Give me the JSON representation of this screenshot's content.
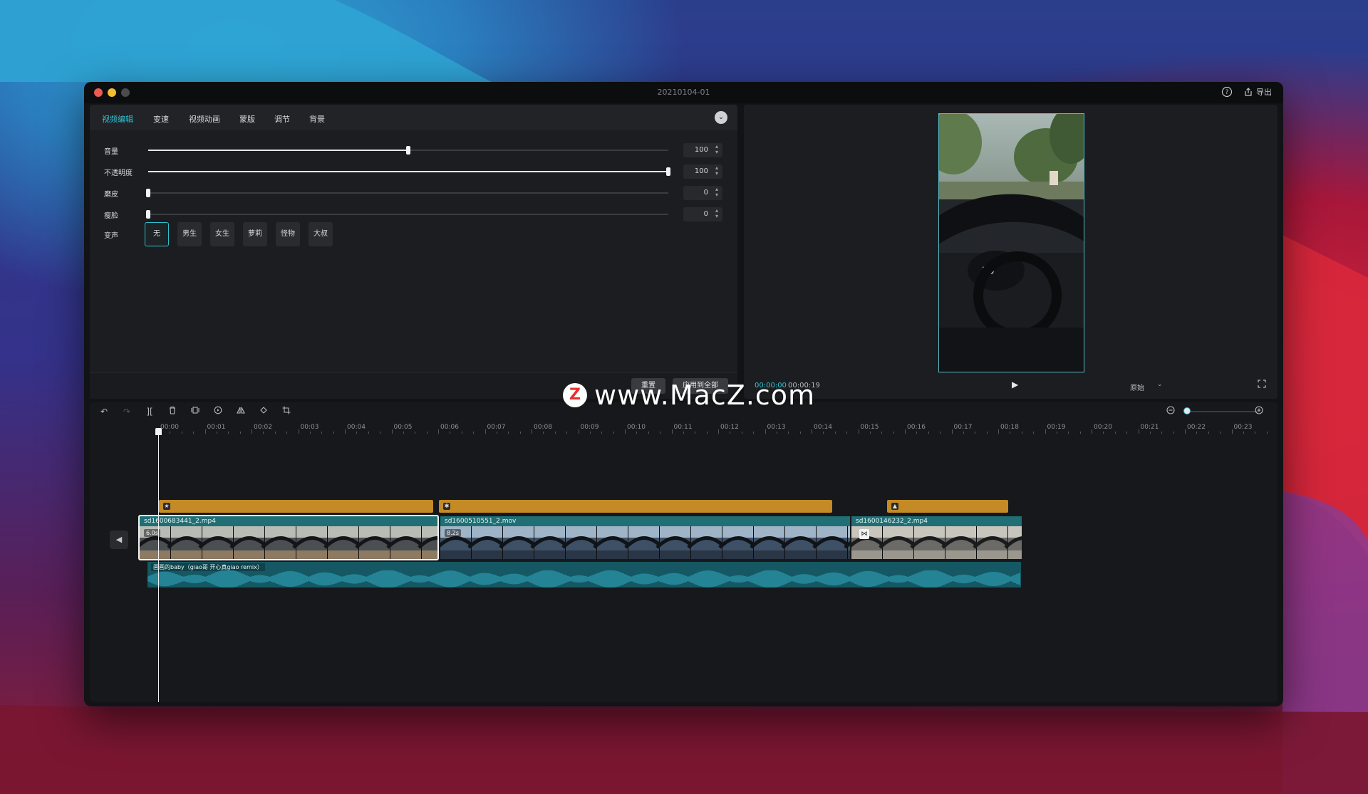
{
  "window": {
    "title": "20210104-01",
    "export_label": "导出"
  },
  "colors": {
    "accent": "#2fc0d0",
    "fx_bar": "#c48a25",
    "clip": "#1f6f74",
    "audio": "#155863"
  },
  "tabs": [
    {
      "label": "视频编辑",
      "active": true
    },
    {
      "label": "变速"
    },
    {
      "label": "视频动画"
    },
    {
      "label": "蒙版"
    },
    {
      "label": "调节"
    },
    {
      "label": "背景"
    }
  ],
  "sliders": [
    {
      "label": "音量",
      "value": "100",
      "level": 0.5
    },
    {
      "label": "不透明度",
      "value": "100",
      "level": 1.0
    },
    {
      "label": "磨皮",
      "value": "0",
      "level": 0.0
    },
    {
      "label": "瘦脸",
      "value": "0",
      "level": 0.0
    }
  ],
  "voice": {
    "label": "变声",
    "options": [
      "无",
      "男生",
      "女生",
      "萝莉",
      "怪物",
      "大叔"
    ],
    "selected": "无"
  },
  "footer": {
    "reset_label": "重置",
    "apply_all_label": "应用到全部"
  },
  "preview": {
    "time_current": "00:00:00",
    "time_total": "00:00:19",
    "ratio_label": "原始"
  },
  "ruler": {
    "ticks": [
      "00:00",
      "00:01",
      "00:02",
      "00:03",
      "00:04",
      "00:05",
      "00:06",
      "00:07",
      "00:08",
      "00:09",
      "00:10",
      "00:11",
      "00:12",
      "00:13",
      "00:14",
      "00:15",
      "00:16",
      "00:17",
      "00:18",
      "00:19",
      "00:20",
      "00:21",
      "00:22",
      "00:23"
    ]
  },
  "clips": [
    {
      "name": "sd1600683441_2.mp4",
      "duration": "6.0s"
    },
    {
      "name": "sd1600510551_2.mov",
      "duration": "8.2s"
    },
    {
      "name": "sd1600146232_2.mp4"
    }
  ],
  "audio": {
    "label": "画画的baby（giao哥 开心真giao remix）"
  },
  "watermark": {
    "logo": "Z",
    "text": "www.MacZ.com"
  },
  "icons": {
    "help": "help-icon",
    "export": "share-icon",
    "undo": "undo-icon",
    "redo": "redo-icon",
    "split": "split-icon",
    "delete": "trash-icon",
    "freeze": "freeze-frame-icon",
    "reverse": "reverse-icon",
    "mirror": "mirror-icon",
    "rotate": "rotate-icon",
    "crop": "crop-icon",
    "zoom_out": "zoom-out-icon",
    "zoom_in": "zoom-in-icon",
    "mute": "speaker-icon",
    "play": "play-icon",
    "fullscreen": "fullscreen-icon"
  }
}
